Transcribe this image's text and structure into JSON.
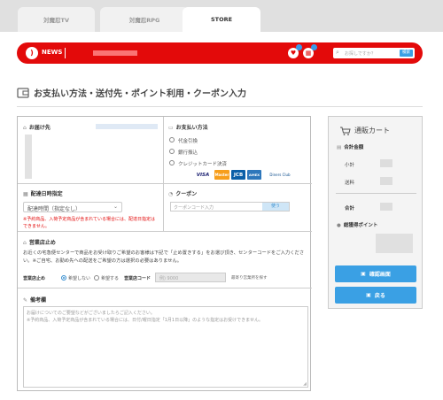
{
  "tabs": [
    {
      "label": "対魔忍TV"
    },
    {
      "label": "対魔忍RPG"
    },
    {
      "label": "STORE"
    }
  ],
  "news": {
    "label": "NEWS"
  },
  "search": {
    "placeholder": "お探しですか？",
    "button": "検索"
  },
  "page": {
    "title": "お支払い方法・送付先・ポイント利用・クーポン入力"
  },
  "delivery": {
    "label": "お届け先"
  },
  "payment": {
    "label": "お支払い方法",
    "options": [
      "代金引換",
      "銀行振込",
      "クレジットカード決済"
    ]
  },
  "cards": [
    "VISA",
    "Master",
    "JCB",
    "AMEX",
    "Diners Club"
  ],
  "schedule": {
    "label": "配達日時指定",
    "select": "配達時間（指定なし）",
    "note": "※予約商品、入荷予定商品が含まれている場合には、配達日指定はできません。"
  },
  "coupon": {
    "label": "クーポン",
    "placeholder": "クーポンコード入力",
    "button": "使う"
  },
  "store_stop": {
    "label": "営業店止め",
    "description": "お近くの宅急便センターで商品をお受け取りご希望のお客様は下記で「止め置きする」をお選び頂き、センターコードをご入力ください。※ご自宅、お勤め先への配送をご希望の方は選択の必要はありません。",
    "option_label": "営業店止め",
    "option_no": "希望しない",
    "option_yes": "希望する",
    "code_label": "営業店コード",
    "code_placeholder": "例) 9000",
    "search_link": "最寄り営業所を探す"
  },
  "remarks": {
    "label": "備考欄",
    "placeholder_line1": "お届けについてのご要望などがございましたらご記入ください。",
    "placeholder_line2": "※予約商品、入荷予定商品が含まれている場合には、日付/曜日指定「1月1日以降」のような指定はお受けできません。"
  },
  "cart": {
    "title": "通販カート",
    "total_label": "合計金額",
    "subtotal": "小計",
    "shipping": "送料",
    "total": "合計",
    "points_label": "総獲得ポイント",
    "confirm": "確認画面",
    "back": "戻る"
  }
}
